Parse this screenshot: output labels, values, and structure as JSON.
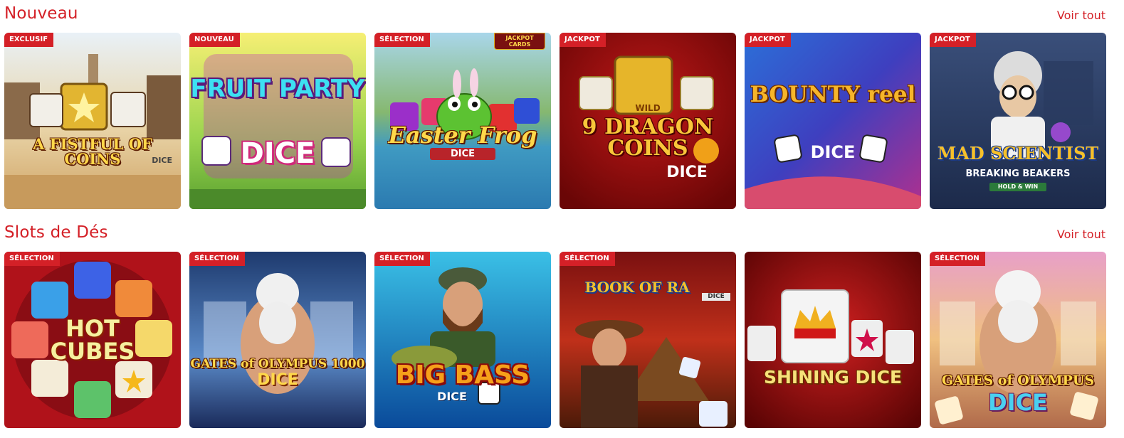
{
  "sections": [
    {
      "title": "Nouveau",
      "voir_tout": "Voir tout",
      "games": [
        {
          "badge": "EXCLUSIF",
          "title": "A FISTFUL OF COINS",
          "sub": "DICE"
        },
        {
          "badge": "NOUVEAU",
          "title": "FRUIT PARTY",
          "sub": "DICE"
        },
        {
          "badge": "SÉLECTION",
          "title": "Easter Frog",
          "sub": "DICE",
          "corner": "JACKPOT CARDS"
        },
        {
          "badge": "JACKPOT",
          "title": "9 DRAGON COINS",
          "sub": "DICE",
          "mark": "WILD"
        },
        {
          "badge": "JACKPOT",
          "title": "BOUNTY reel",
          "sub": "DICE"
        },
        {
          "badge": "JACKPOT",
          "title": "MAD SCIENTIST",
          "sub": "BREAKING BEAKERS",
          "tag": "HOLD & WIN"
        }
      ]
    },
    {
      "title": "Slots de Dés",
      "voir_tout": "Voir tout",
      "games": [
        {
          "badge": "SÉLECTION",
          "title": "HOT CUBES",
          "sub": ""
        },
        {
          "badge": "SÉLECTION",
          "title": "GATES of OLYMPUS 1000",
          "sub": "DICE"
        },
        {
          "badge": "SÉLECTION",
          "title": "BIG BASS",
          "sub": "DICE"
        },
        {
          "badge": "SÉLECTION",
          "title": "BOOK OF RA",
          "sub": "DICE"
        },
        {
          "badge": "",
          "title": "SHINING DICE",
          "sub": ""
        },
        {
          "badge": "SÉLECTION",
          "title": "GATES of OLYMPUS",
          "sub": "DICE"
        }
      ]
    }
  ],
  "colors": {
    "accent": "#d42027",
    "badge_text": "#ffffff"
  }
}
